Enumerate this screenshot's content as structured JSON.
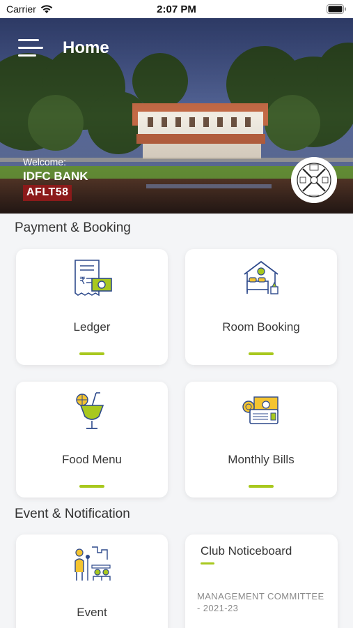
{
  "status_bar": {
    "carrier": "Carrier",
    "time": "2:07 PM"
  },
  "header": {
    "title": "Home"
  },
  "user": {
    "welcome": "Welcome:",
    "company": "IDFC BANK",
    "member_code": "AFLT58"
  },
  "colors": {
    "accent": "#a8c81e",
    "badge": "#8b1a1a",
    "icon_blue": "#2e4a8c",
    "icon_yellow": "#f4c430"
  },
  "sections": {
    "payment": {
      "title": "Payment & Booking",
      "items": [
        {
          "label": "Ledger",
          "icon": "ledger-icon"
        },
        {
          "label": "Room Booking",
          "icon": "room-booking-icon"
        },
        {
          "label": "Food Menu",
          "icon": "food-menu-icon"
        },
        {
          "label": "Monthly Bills",
          "icon": "monthly-bills-icon"
        }
      ]
    },
    "events": {
      "title": "Event & Notification",
      "items": [
        {
          "label": "Event",
          "icon": "event-icon"
        }
      ],
      "noticeboard": {
        "title": "Club Noticeboard",
        "item": "MANAGEMENT COMMITTEE - 2021-23"
      }
    }
  }
}
